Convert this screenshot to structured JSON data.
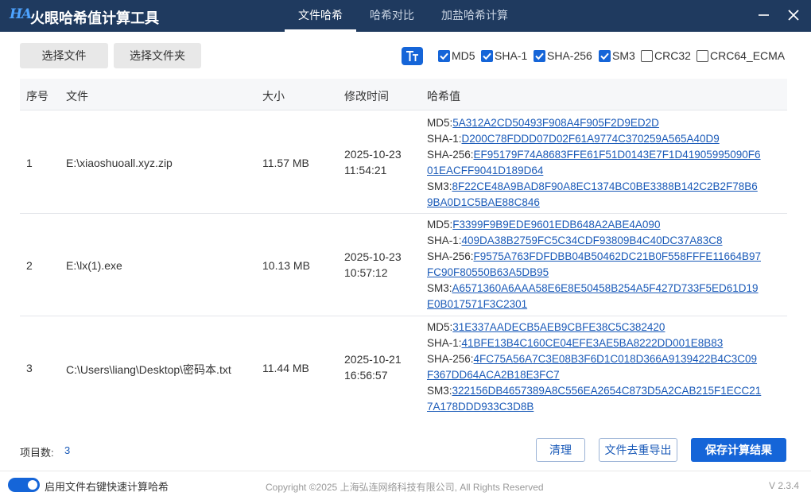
{
  "app": {
    "logo_text": "HA",
    "title": "火眼哈希值计算工具"
  },
  "tabs": [
    {
      "label": "文件哈希",
      "active": true
    },
    {
      "label": "哈希对比",
      "active": false
    },
    {
      "label": "加盐哈希计算",
      "active": false
    }
  ],
  "window_controls": {
    "minimize_icon": "minimize-icon",
    "close_icon": "close-icon"
  },
  "toolbar": {
    "select_file_label": "选择文件",
    "select_folder_label": "选择文件夹",
    "font_size_icon": "text-size-icon",
    "algorithms": [
      {
        "label": "MD5",
        "checked": true
      },
      {
        "label": "SHA-1",
        "checked": true
      },
      {
        "label": "SHA-256",
        "checked": true
      },
      {
        "label": "SM3",
        "checked": true
      },
      {
        "label": "CRC32",
        "checked": false
      },
      {
        "label": "CRC64_ECMA",
        "checked": false
      }
    ]
  },
  "table": {
    "headers": {
      "index": "序号",
      "file": "文件",
      "size": "大小",
      "mtime": "修改时间",
      "hash": "哈希值"
    },
    "rows": [
      {
        "index": "1",
        "file": "E:\\xiaoshuoall.xyz.zip",
        "size": "11.57 MB",
        "date": "2025-10-23",
        "time": "11:54:21",
        "hashes": [
          {
            "prefix": "MD5:",
            "lines": [
              "5A312A2CD50493F908A4F905F2D9ED2D"
            ]
          },
          {
            "prefix": "SHA-1:",
            "lines": [
              "D200C78FDDD07D02F61A9774C370259A565A40D9"
            ]
          },
          {
            "prefix": "SHA-256:",
            "lines": [
              "EF95179F74A8683FFE61F51D0143E7F1D41905995090F6",
              "01EACFF9041D189D64"
            ]
          },
          {
            "prefix": "SM3:",
            "lines": [
              "8F22CE48A9BAD8F90A8EC1374BC0BE3388B142C2B2F78B6",
              "9BA0D1C5BAE88C846"
            ]
          }
        ]
      },
      {
        "index": "2",
        "file": "E:\\lx(1).exe",
        "size": "10.13 MB",
        "date": "2025-10-23",
        "time": "10:57:12",
        "hashes": [
          {
            "prefix": "MD5:",
            "lines": [
              "F3399F9B9EDE9601EDB648A2ABE4A090"
            ]
          },
          {
            "prefix": "SHA-1:",
            "lines": [
              "409DA38B2759FC5C34CDF93809B4C40DC37A83C8"
            ]
          },
          {
            "prefix": "SHA-256:",
            "lines": [
              "F9575A763FDFDBB04B50462DC21B0F558FFFE11664B97",
              "FC90F80550B63A5DB95"
            ]
          },
          {
            "prefix": "SM3:",
            "lines": [
              "A6571360A6AAA58E6E8E50458B254A5F427D733F5ED61D19",
              "E0B017571F3C2301"
            ]
          }
        ]
      },
      {
        "index": "3",
        "file": "C:\\Users\\liang\\Desktop\\密码本.txt",
        "size": "11.44 MB",
        "date": "2025-10-21",
        "time": "16:56:57",
        "hashes": [
          {
            "prefix": "MD5:",
            "lines": [
              "31E337AADECB5AEB9CBFE38C5C382420"
            ]
          },
          {
            "prefix": "SHA-1:",
            "lines": [
              "41BFE13B4C160CE04EFE3AE5BA8222DD001E8B83"
            ]
          },
          {
            "prefix": "SHA-256:",
            "lines": [
              "4FC75A56A7C3E08B3F6D1C018D366A9139422B4C3C09",
              "F367DD64ACA2B18E3FC7"
            ]
          },
          {
            "prefix": "SM3:",
            "lines": [
              "322156DB4657389A8C556EA2654C873D5A2CAB215F1ECC21",
              "7A178DDD933C3D8B"
            ]
          }
        ]
      }
    ]
  },
  "footer": {
    "count_label": "项目数:",
    "count_value": "3",
    "clear_label": "清理",
    "dedupe_export_label": "文件去重导出",
    "save_label": "保存计算结果",
    "context_menu_toggle_label": "启用文件右键快速计算哈希",
    "context_menu_enabled": true,
    "copyright": "Copyright ©2025 上海弘连网络科技有限公司, All Rights Reserved",
    "version": "V 2.3.4"
  },
  "colors": {
    "titlebar": "#1f3a5f",
    "accent": "#1565d8",
    "link": "#1a5ab8"
  }
}
